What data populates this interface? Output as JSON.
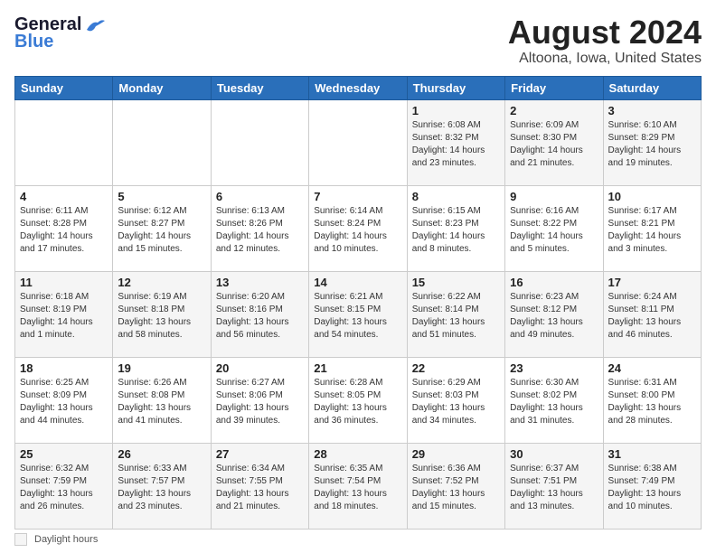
{
  "header": {
    "logo_line1": "General",
    "logo_line2": "Blue",
    "title": "August 2024",
    "subtitle": "Altoona, Iowa, United States"
  },
  "footer": {
    "daylight_label": "Daylight hours"
  },
  "weekdays": [
    "Sunday",
    "Monday",
    "Tuesday",
    "Wednesday",
    "Thursday",
    "Friday",
    "Saturday"
  ],
  "weeks": [
    [
      {
        "day": "",
        "info": ""
      },
      {
        "day": "",
        "info": ""
      },
      {
        "day": "",
        "info": ""
      },
      {
        "day": "",
        "info": ""
      },
      {
        "day": "1",
        "info": "Sunrise: 6:08 AM\nSunset: 8:32 PM\nDaylight: 14 hours and 23 minutes."
      },
      {
        "day": "2",
        "info": "Sunrise: 6:09 AM\nSunset: 8:30 PM\nDaylight: 14 hours and 21 minutes."
      },
      {
        "day": "3",
        "info": "Sunrise: 6:10 AM\nSunset: 8:29 PM\nDaylight: 14 hours and 19 minutes."
      }
    ],
    [
      {
        "day": "4",
        "info": "Sunrise: 6:11 AM\nSunset: 8:28 PM\nDaylight: 14 hours and 17 minutes."
      },
      {
        "day": "5",
        "info": "Sunrise: 6:12 AM\nSunset: 8:27 PM\nDaylight: 14 hours and 15 minutes."
      },
      {
        "day": "6",
        "info": "Sunrise: 6:13 AM\nSunset: 8:26 PM\nDaylight: 14 hours and 12 minutes."
      },
      {
        "day": "7",
        "info": "Sunrise: 6:14 AM\nSunset: 8:24 PM\nDaylight: 14 hours and 10 minutes."
      },
      {
        "day": "8",
        "info": "Sunrise: 6:15 AM\nSunset: 8:23 PM\nDaylight: 14 hours and 8 minutes."
      },
      {
        "day": "9",
        "info": "Sunrise: 6:16 AM\nSunset: 8:22 PM\nDaylight: 14 hours and 5 minutes."
      },
      {
        "day": "10",
        "info": "Sunrise: 6:17 AM\nSunset: 8:21 PM\nDaylight: 14 hours and 3 minutes."
      }
    ],
    [
      {
        "day": "11",
        "info": "Sunrise: 6:18 AM\nSunset: 8:19 PM\nDaylight: 14 hours and 1 minute."
      },
      {
        "day": "12",
        "info": "Sunrise: 6:19 AM\nSunset: 8:18 PM\nDaylight: 13 hours and 58 minutes."
      },
      {
        "day": "13",
        "info": "Sunrise: 6:20 AM\nSunset: 8:16 PM\nDaylight: 13 hours and 56 minutes."
      },
      {
        "day": "14",
        "info": "Sunrise: 6:21 AM\nSunset: 8:15 PM\nDaylight: 13 hours and 54 minutes."
      },
      {
        "day": "15",
        "info": "Sunrise: 6:22 AM\nSunset: 8:14 PM\nDaylight: 13 hours and 51 minutes."
      },
      {
        "day": "16",
        "info": "Sunrise: 6:23 AM\nSunset: 8:12 PM\nDaylight: 13 hours and 49 minutes."
      },
      {
        "day": "17",
        "info": "Sunrise: 6:24 AM\nSunset: 8:11 PM\nDaylight: 13 hours and 46 minutes."
      }
    ],
    [
      {
        "day": "18",
        "info": "Sunrise: 6:25 AM\nSunset: 8:09 PM\nDaylight: 13 hours and 44 minutes."
      },
      {
        "day": "19",
        "info": "Sunrise: 6:26 AM\nSunset: 8:08 PM\nDaylight: 13 hours and 41 minutes."
      },
      {
        "day": "20",
        "info": "Sunrise: 6:27 AM\nSunset: 8:06 PM\nDaylight: 13 hours and 39 minutes."
      },
      {
        "day": "21",
        "info": "Sunrise: 6:28 AM\nSunset: 8:05 PM\nDaylight: 13 hours and 36 minutes."
      },
      {
        "day": "22",
        "info": "Sunrise: 6:29 AM\nSunset: 8:03 PM\nDaylight: 13 hours and 34 minutes."
      },
      {
        "day": "23",
        "info": "Sunrise: 6:30 AM\nSunset: 8:02 PM\nDaylight: 13 hours and 31 minutes."
      },
      {
        "day": "24",
        "info": "Sunrise: 6:31 AM\nSunset: 8:00 PM\nDaylight: 13 hours and 28 minutes."
      }
    ],
    [
      {
        "day": "25",
        "info": "Sunrise: 6:32 AM\nSunset: 7:59 PM\nDaylight: 13 hours and 26 minutes."
      },
      {
        "day": "26",
        "info": "Sunrise: 6:33 AM\nSunset: 7:57 PM\nDaylight: 13 hours and 23 minutes."
      },
      {
        "day": "27",
        "info": "Sunrise: 6:34 AM\nSunset: 7:55 PM\nDaylight: 13 hours and 21 minutes."
      },
      {
        "day": "28",
        "info": "Sunrise: 6:35 AM\nSunset: 7:54 PM\nDaylight: 13 hours and 18 minutes."
      },
      {
        "day": "29",
        "info": "Sunrise: 6:36 AM\nSunset: 7:52 PM\nDaylight: 13 hours and 15 minutes."
      },
      {
        "day": "30",
        "info": "Sunrise: 6:37 AM\nSunset: 7:51 PM\nDaylight: 13 hours and 13 minutes."
      },
      {
        "day": "31",
        "info": "Sunrise: 6:38 AM\nSunset: 7:49 PM\nDaylight: 13 hours and 10 minutes."
      }
    ]
  ]
}
